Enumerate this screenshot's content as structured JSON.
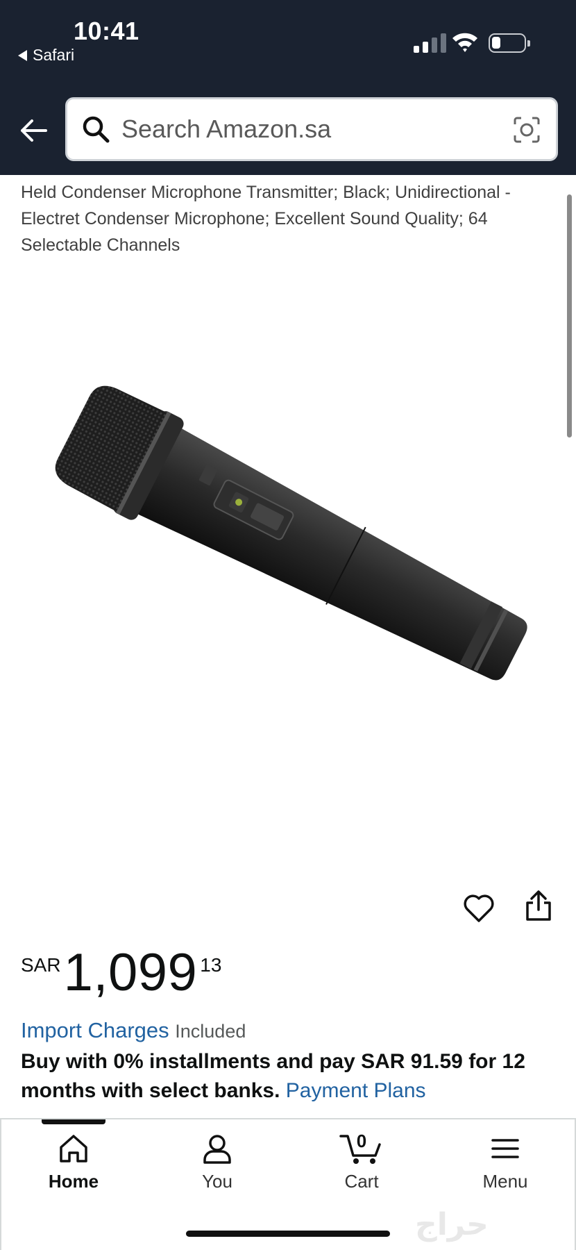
{
  "status_bar": {
    "time": "10:41",
    "back_app": "Safari"
  },
  "search": {
    "placeholder": "Search Amazon.sa"
  },
  "product": {
    "title": "Held Condenser Microphone Transmitter; Black; Unidirectional - Electret Condenser Microphone; Excellent Sound Quality; 64 Selectable Channels"
  },
  "price": {
    "currency": "SAR",
    "whole": "1,099",
    "fraction": "13"
  },
  "import_charges": {
    "link": "Import Charges",
    "status": "Included"
  },
  "installments": {
    "text": "Buy with 0% installments and pay SAR 91.59 for 12 months with select banks.",
    "link": "Payment Plans"
  },
  "bottom_nav": {
    "items": [
      {
        "label": "Home",
        "icon": "home-icon",
        "active": true
      },
      {
        "label": "You",
        "icon": "person-icon"
      },
      {
        "label": "Cart",
        "icon": "cart-icon",
        "count": "0"
      },
      {
        "label": "Menu",
        "icon": "menu-icon"
      }
    ]
  },
  "watermark": "حراج",
  "colors": {
    "header_bg": "#1a2230",
    "link": "#2162a1"
  }
}
